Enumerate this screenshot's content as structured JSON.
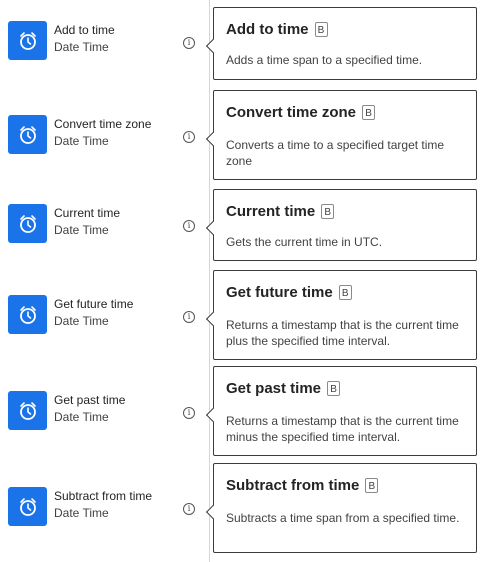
{
  "actions": [
    {
      "name": "Add to time",
      "subtitle": "Date Time",
      "icon": "timer-icon"
    },
    {
      "name": "Convert time zone",
      "subtitle": "Date Time",
      "icon": "timer-icon"
    },
    {
      "name": "Current time",
      "subtitle": "Date Time",
      "icon": "timer-icon"
    },
    {
      "name": "Get future time",
      "subtitle": "Date Time",
      "icon": "timer-icon"
    },
    {
      "name": "Get past time",
      "subtitle": "Date Time",
      "icon": "timer-icon"
    },
    {
      "name": "Subtract from time",
      "subtitle": "Date Time",
      "icon": "timer-icon"
    }
  ],
  "info_icon_glyph": "i",
  "cards": [
    {
      "title": "Add to time",
      "badge": "B",
      "description": "Adds a time span to a specified time."
    },
    {
      "title": "Convert time zone",
      "badge": "B",
      "description": "Converts a time to a specified target time zone"
    },
    {
      "title": "Current time",
      "badge": "B",
      "description": "Gets the current time in UTC."
    },
    {
      "title": "Get future time",
      "badge": "B",
      "description": "Returns a timestamp that is the current time plus the specified time interval."
    },
    {
      "title": "Get past time",
      "badge": "B",
      "description": "Returns a timestamp that is the current time minus the specified time interval."
    },
    {
      "title": "Subtract from time",
      "badge": "B",
      "description": "Subtracts a time span from a specified time."
    }
  ],
  "colors": {
    "icon_bg": "#1a73e8",
    "card_border": "#3b3b3b"
  }
}
